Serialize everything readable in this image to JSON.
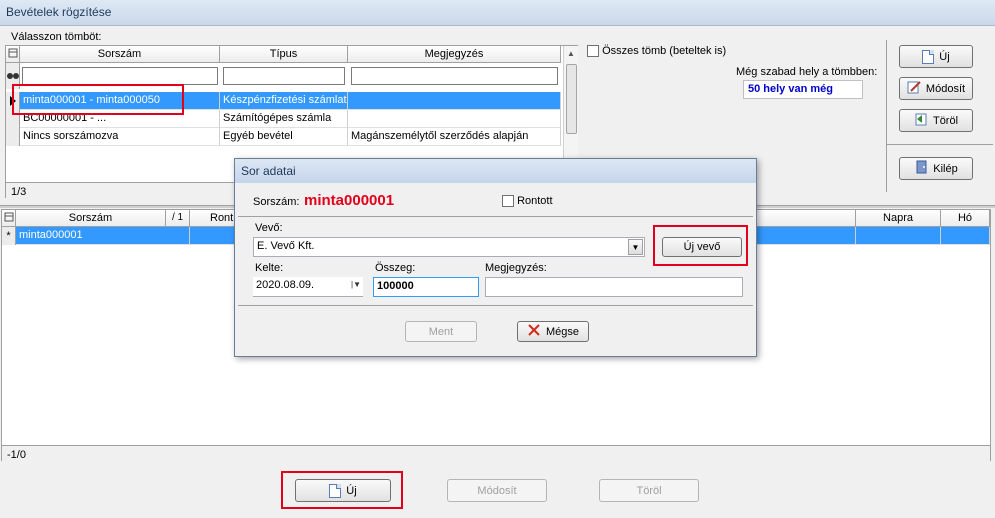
{
  "window": {
    "title": "Bevételek rögzítése"
  },
  "top": {
    "select_label": "Válasszon tömböt:",
    "columns": [
      "Sorszám",
      "Típus",
      "Megjegyzés"
    ],
    "rows": [
      {
        "sorszam": "minta000001 - minta000050",
        "tipus": "Készpénzfizetési számlat...",
        "megjegyzes": ""
      },
      {
        "sorszam": "BC00000001 - ...",
        "tipus": "Számítógépes számla",
        "megjegyzes": ""
      },
      {
        "sorszam": "Nincs sorszámozva",
        "tipus": "Egyéb bevétel",
        "megjegyzes": "Magánszemélytől szerződés alapján"
      }
    ],
    "status": "1/3",
    "all_blocks_label": "Összes tömb (beteltek is)",
    "free_space_label": "Még szabad hely a tömbben:",
    "free_space_value": "50 hely van még"
  },
  "right_buttons": {
    "new": "Új",
    "modify": "Módosít",
    "delete": "Töröl",
    "exit": "Kilép"
  },
  "bottom_grid": {
    "columns": [
      "Sorszám",
      "/ 1",
      "Ront",
      "Napra",
      "Hó"
    ],
    "row_value": "minta000001",
    "status": "-1/0"
  },
  "bottom_buttons": {
    "new": "Új",
    "modify": "Módosít",
    "delete": "Töröl"
  },
  "dialog": {
    "title": "Sor adatai",
    "sorszam_label": "Sorszám:",
    "sorszam_value": "minta000001",
    "rontott_label": "Rontott",
    "vevo_label": "Vevő:",
    "vevo_value": "E. Vevő Kft.",
    "new_customer_button": "Új vevő",
    "kelte_label": "Kelte:",
    "kelte_value": "2020.08.09.",
    "osszeg_label": "Összeg:",
    "osszeg_value": "100000",
    "megjegyzes_label": "Megjegyzés:",
    "megjegyzes_value": "",
    "save_button": "Ment",
    "cancel_button": "Mégse"
  },
  "colors": {
    "selection": "#3399ff",
    "highlight_red": "#e3001b",
    "sorszam_red": "#e3001b",
    "free_space_blue": "#0000cc"
  }
}
